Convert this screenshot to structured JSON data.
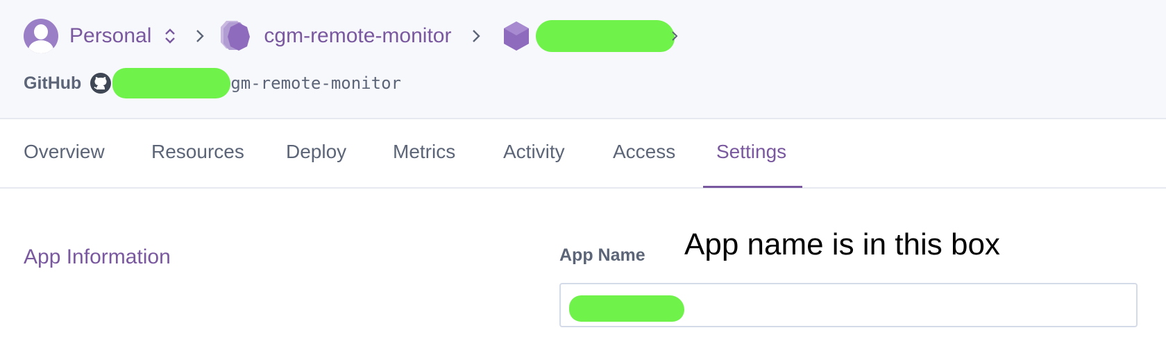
{
  "breadcrumb": {
    "account_label": "Personal",
    "pipeline_label": "cgm-remote-monitor",
    "app_name_redacted": ""
  },
  "github": {
    "label": "GitHub",
    "repo_visible_suffix": "gm-remote-monitor"
  },
  "tabs": [
    {
      "label": "Overview",
      "active": false
    },
    {
      "label": "Resources",
      "active": false
    },
    {
      "label": "Deploy",
      "active": false
    },
    {
      "label": "Metrics",
      "active": false
    },
    {
      "label": "Activity",
      "active": false
    },
    {
      "label": "Access",
      "active": false
    },
    {
      "label": "Settings",
      "active": true
    }
  ],
  "main": {
    "section_title": "App Information",
    "app_name_label": "App Name",
    "app_name_value": "",
    "annotation_text": "App name is in this box"
  },
  "colors": {
    "accent": "#79589f",
    "text": "#5c6577",
    "header_bg": "#f7f8fb",
    "redaction": "#6ff34b"
  },
  "icons": [
    "user-avatar-icon",
    "updown-chevron-icon",
    "chevron-right-icon",
    "pipeline-icon",
    "app-hexagon-icon",
    "github-icon"
  ]
}
